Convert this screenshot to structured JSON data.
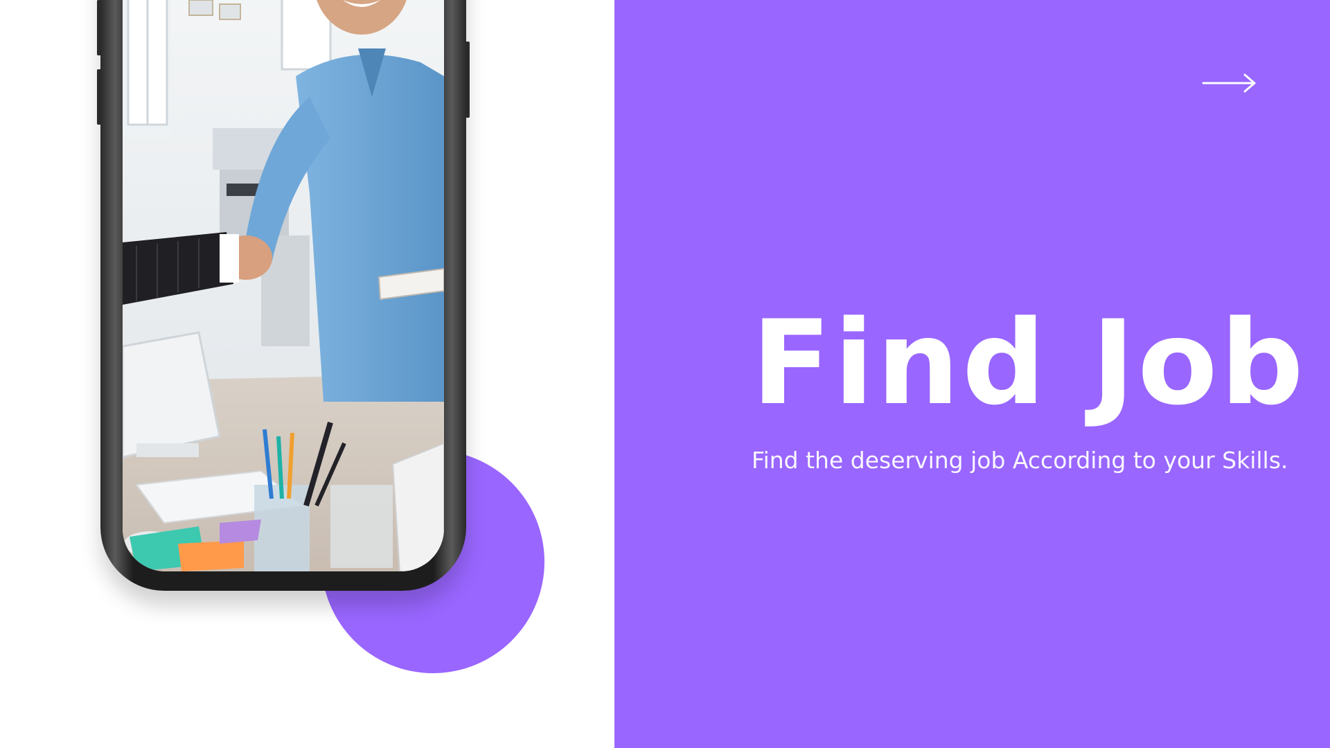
{
  "slide": {
    "title": "Find Job",
    "subtitle": "Find the deserving job According to your Skills.",
    "next_icon": "arrow-right-icon",
    "phone_image": "handshake-office-photo"
  },
  "colors": {
    "accent": "#9966ff",
    "background": "#ffffff",
    "text_on_accent": "#ffffff",
    "phone_frame": "#1d1d1d"
  }
}
